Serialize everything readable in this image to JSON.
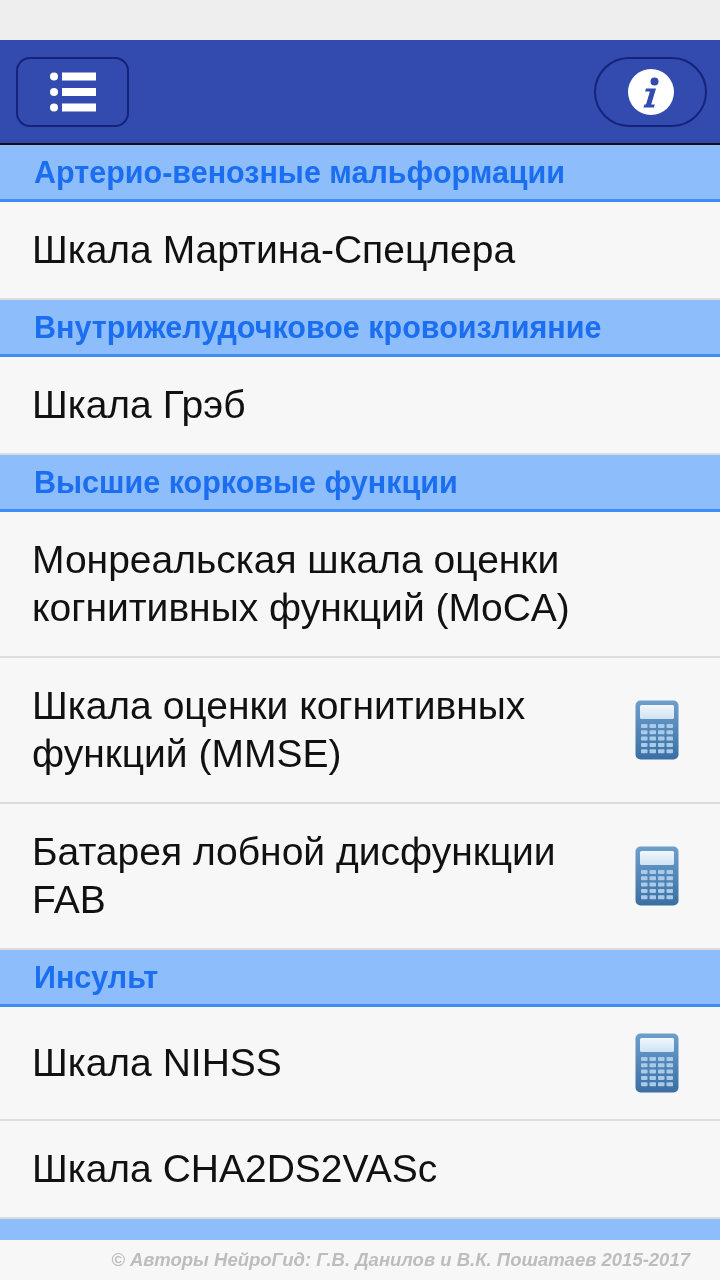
{
  "sections": [
    {
      "kind": "header",
      "title": "Артерио-венозные мальформации",
      "items": [
        {
          "title": "Шкала Мартина-Спецлера",
          "calculator": false
        }
      ]
    },
    {
      "kind": "header",
      "title": "Внутрижелудочковое кровоизлияние",
      "items": [
        {
          "title": "Шкала Грэб",
          "calculator": false
        }
      ]
    },
    {
      "kind": "header",
      "title": "Высшие корковые функции",
      "items": [
        {
          "title": "Монреальская шкала оценки когнитивных функций (MoCA)",
          "calculator": false
        },
        {
          "title": "Шкала оценки когнитивных функций (MMSE)",
          "calculator": true
        },
        {
          "title": "Батарея лобной дисфункции FAB",
          "calculator": true
        }
      ]
    },
    {
      "kind": "header",
      "title": "Инсульт",
      "items": [
        {
          "title": "Шкала NIHSS",
          "calculator": true
        },
        {
          "title": "Шкала CHA2DS2VASc",
          "calculator": false
        }
      ]
    },
    {
      "kind": "clipped"
    }
  ],
  "footer": {
    "text": "© Авторы НейроГид: Г.В. Данилов и В.К. Пошатаев 2015-2017"
  }
}
